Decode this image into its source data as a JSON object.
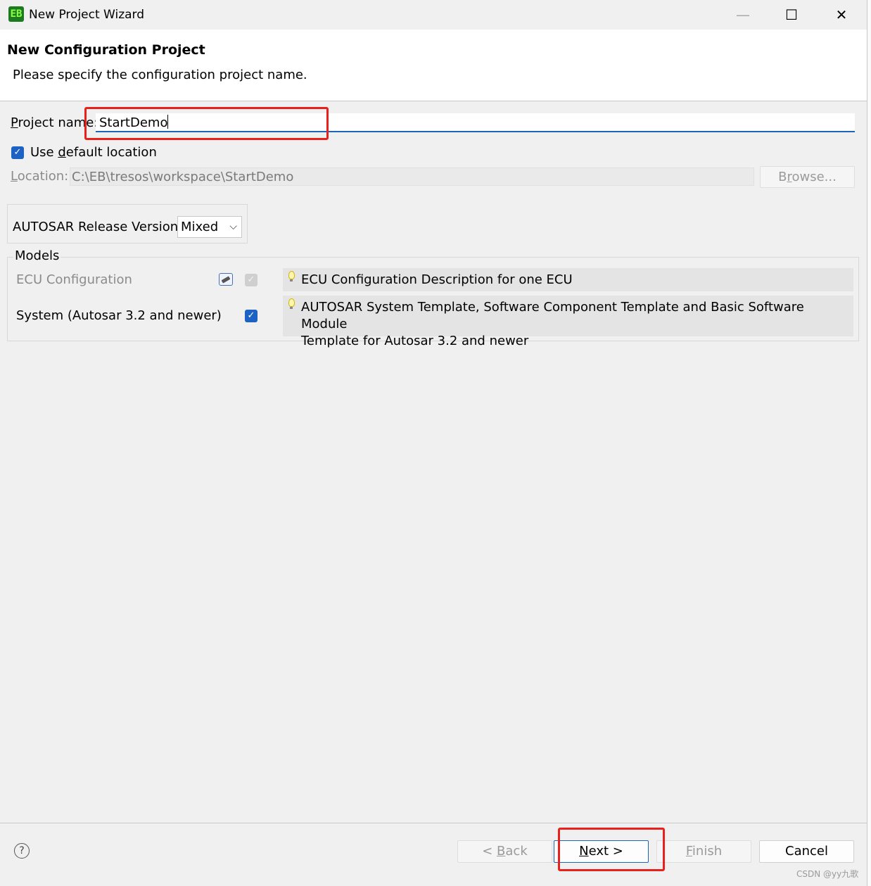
{
  "window": {
    "title": "New Project Wizard",
    "minimize_glyph": "—",
    "maximize_glyph": "☐",
    "close_glyph": "✕",
    "icon": "eb-tresos-app-icon",
    "icon_text": "EB"
  },
  "header": {
    "title": "New Configuration Project",
    "description": "Please specify the configuration project name."
  },
  "form": {
    "project_name_label_mnemonic": "P",
    "project_name_label_rest": "roject name:",
    "project_name_value": "StartDemo",
    "use_default_location_pre": "Use ",
    "use_default_location_mnemonic": "d",
    "use_default_location_post": "efault location",
    "use_default_location_checked": true,
    "location_label_mnemonic": "L",
    "location_label_rest": "ocation:",
    "location_value": "C:\\EB\\tresos\\workspace\\StartDemo",
    "browse_pre": "B",
    "browse_mnemonic": "r",
    "browse_post": "owse...",
    "autosar_release_label": "AUTOSAR Release Version:",
    "autosar_release_value": "Mixed"
  },
  "models": {
    "group_label": "Models",
    "rows": [
      {
        "name": "ECU Configuration",
        "enabled": false,
        "checked": true,
        "description": "ECU Configuration Description for one ECU"
      },
      {
        "name": "System (Autosar 3.2 and newer)",
        "enabled": true,
        "checked": true,
        "description_line1": "AUTOSAR System Template, Software Component Template and Basic Software Module",
        "description_line2": "Template for Autosar 3.2 and newer"
      }
    ]
  },
  "footer": {
    "help_glyph": "?",
    "back_pre": "< ",
    "back_mnemonic": "B",
    "back_post": "ack",
    "next_mnemonic": "N",
    "next_post": "ext >",
    "finish_mnemonic": "F",
    "finish_post": "inish",
    "cancel": "Cancel"
  },
  "watermark": "CSDN @yy九歌",
  "colors": {
    "accent": "#1c62c4",
    "highlight_red": "#e8211c",
    "header_bg": "#ffffff",
    "dialog_bg": "#f0f0f0"
  }
}
